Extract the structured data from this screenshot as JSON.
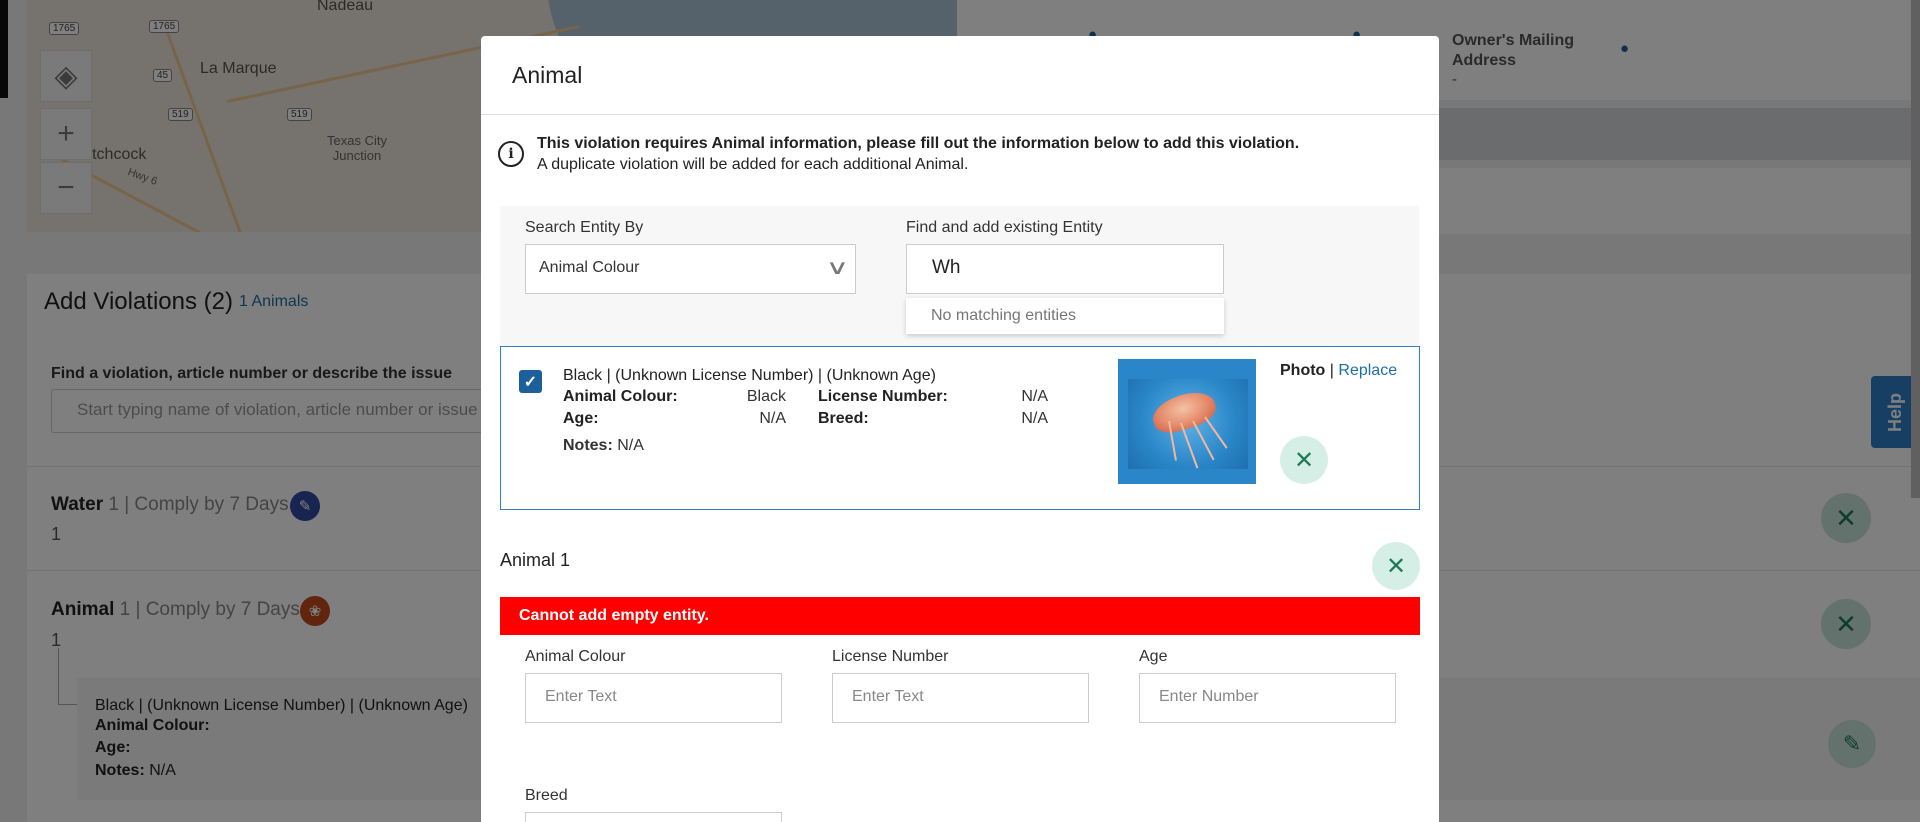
{
  "map": {
    "town_labels": [
      "Nadeau",
      "La Marque",
      "Hitchcock"
    ],
    "small_label": "Texas City\nJunction",
    "road_label": "Hwy 6",
    "shields": [
      "1765",
      "1765",
      "45",
      "519",
      "519"
    ],
    "controls": {
      "zoom_in": "+",
      "zoom_out": "−",
      "layers": "◈"
    }
  },
  "owner": {
    "label": "Owner's Mailing\nAddress",
    "value": "-"
  },
  "violations": {
    "title": "Add Violations (2)",
    "count_link": "1 Animals",
    "find_label": "Find a violation, article number or describe the issue",
    "find_placeholder": "Start typing name of violation, article number or issue",
    "rows": [
      {
        "name": "Water",
        "meta": "1 | Comply by 7 Days",
        "sub": "1",
        "icon_color": "#2f4aa0",
        "icon": "notes-icon"
      },
      {
        "name": "Animal",
        "meta": "1 | Comply by 7 Days",
        "sub": "1",
        "icon_color": "#c24a1c",
        "icon": "paw-icon"
      }
    ],
    "entity": {
      "head": "Black | (Unknown License Number) | (Unknown Age)",
      "colour_label": "Animal Colour:",
      "age_label": "Age:",
      "notes_label": "Notes:",
      "notes_value": "N/A"
    }
  },
  "help": "Help",
  "modal": {
    "title": "Animal",
    "notice_bold": "This violation requires Animal information, please fill out the information below to add this violation.",
    "notice": "A duplicate violation will be added for each additional Animal.",
    "search_by_label": "Search Entity By",
    "search_by_value": "Animal Colour",
    "find_label": "Find and add existing Entity",
    "find_value": "Wh",
    "dropdown_text": "No matching entities",
    "card": {
      "head": "Black | (Unknown License Number) | (Unknown Age)",
      "colour_label": "Animal Colour:",
      "colour_value": "Black",
      "license_label": "License Number:",
      "license_value": "N/A",
      "age_label": "Age:",
      "age_value": "N/A",
      "breed_label": "Breed:",
      "breed_value": "N/A",
      "notes_label": "Notes:",
      "notes_value": "N/A",
      "photo_label": "Photo",
      "photo_sep": "|",
      "replace_link": "Replace"
    },
    "animal1_title": "Animal 1",
    "error": "Cannot add empty entity.",
    "fields": [
      {
        "label": "Animal Colour",
        "placeholder": "Enter Text"
      },
      {
        "label": "License Number",
        "placeholder": "Enter Text"
      },
      {
        "label": "Age",
        "placeholder": "Enter Number"
      },
      {
        "label": "Breed",
        "placeholder": ""
      }
    ]
  },
  "colors": {
    "accent": "#1d5f9a",
    "link": "#1d6fa8",
    "error": "#ff0000",
    "success_bg": "#d6efe6",
    "success_fg": "#1e7a58"
  }
}
